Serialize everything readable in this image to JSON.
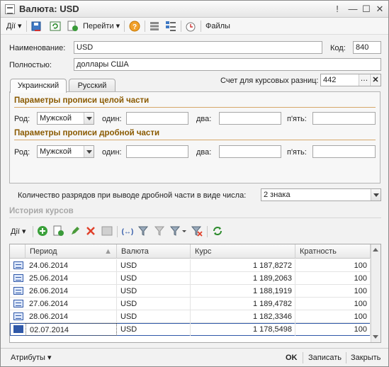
{
  "window": {
    "title": "Валюта: USD"
  },
  "toolbar": {
    "actions_label": "Дії",
    "goto_label": "Перейти",
    "files_label": "Файлы"
  },
  "form": {
    "name_label": "Наименование:",
    "name_value": "USD",
    "code_label": "Код:",
    "code_value": "840",
    "full_label": "Полностью:",
    "full_value": "доллары США",
    "account_label": "Счет для курсовых разниц:",
    "account_value": "442"
  },
  "tabs": [
    {
      "label": "Украинский",
      "active": true
    },
    {
      "label": "Русский",
      "active": false
    }
  ],
  "integer_part": {
    "title": "Параметры прописи целой части",
    "gender_label": "Род:",
    "gender_value": "Мужской",
    "one_label": "один:",
    "two_label": "два:",
    "five_label": "п'ять:"
  },
  "fraction_part": {
    "title": "Параметры прописи дробной части",
    "gender_label": "Род:",
    "gender_value": "Мужской",
    "one_label": "один:",
    "two_label": "два:",
    "five_label": "п'ять:"
  },
  "digits": {
    "label": "Количество разрядов при выводе дробной части в виде числа:",
    "value": "2 знака"
  },
  "history": {
    "title": "История курсов",
    "actions_label": "Дії",
    "columns": [
      "Период",
      "Валюта",
      "Курс",
      "Кратность"
    ],
    "rows": [
      {
        "period": "24.06.2014",
        "currency": "USD",
        "rate": "1 187,8272",
        "multiplicity": "100"
      },
      {
        "period": "25.06.2014",
        "currency": "USD",
        "rate": "1 189,2063",
        "multiplicity": "100"
      },
      {
        "period": "26.06.2014",
        "currency": "USD",
        "rate": "1 188,1919",
        "multiplicity": "100"
      },
      {
        "period": "27.06.2014",
        "currency": "USD",
        "rate": "1 189,4782",
        "multiplicity": "100"
      },
      {
        "period": "28.06.2014",
        "currency": "USD",
        "rate": "1 182,3346",
        "multiplicity": "100"
      },
      {
        "period": "02.07.2014",
        "currency": "USD",
        "rate": "1 178,5498",
        "multiplicity": "100"
      }
    ]
  },
  "footer": {
    "attributes_label": "Атрибуты",
    "ok_label": "OK",
    "save_label": "Записать",
    "close_label": "Закрыть"
  },
  "colors": {
    "section_title": "#8a5a00",
    "selected_row": "#2f58a8"
  }
}
